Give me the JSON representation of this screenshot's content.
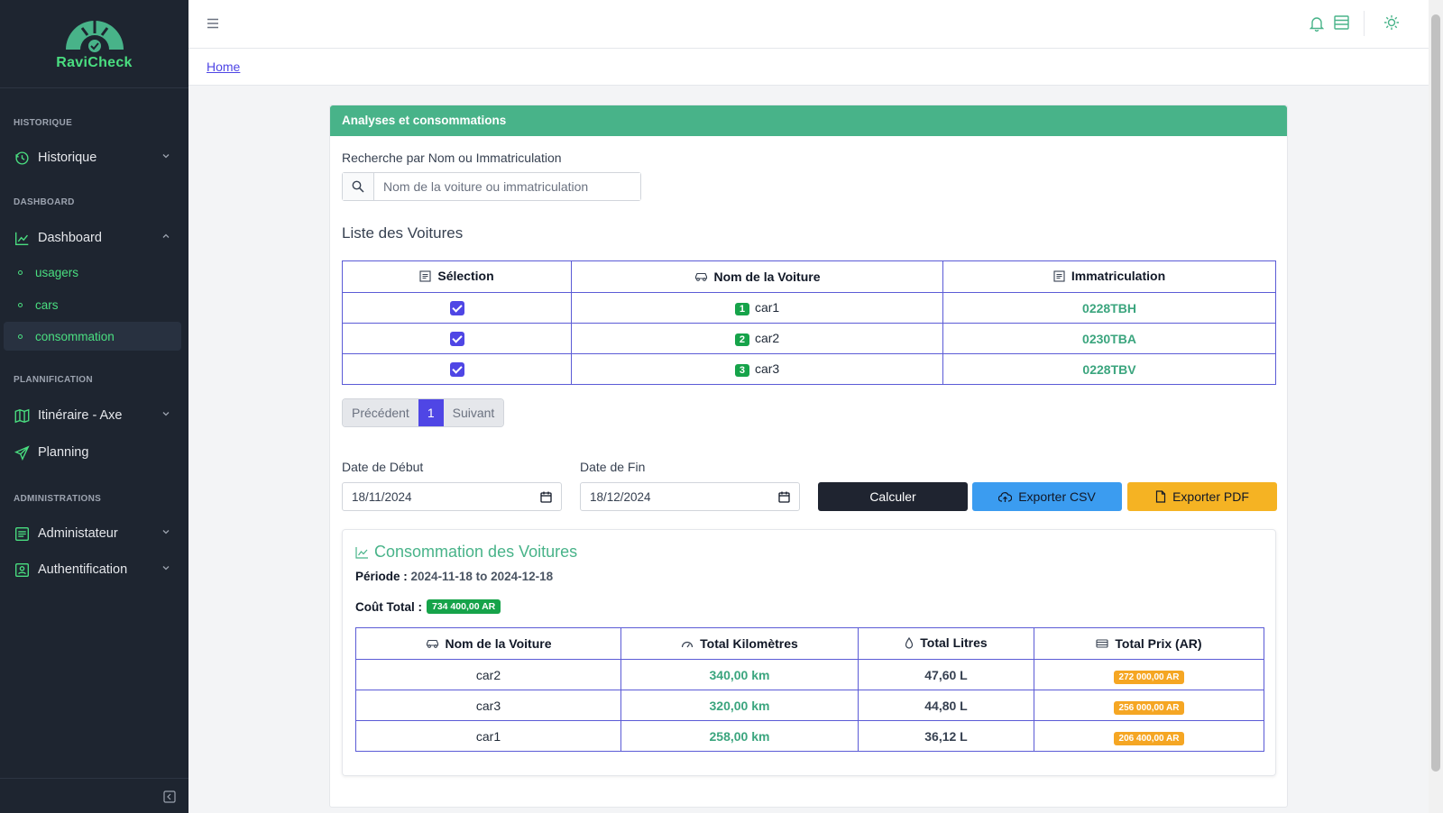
{
  "brand": {
    "name": "RaviCheck"
  },
  "sidebar": {
    "sections": [
      {
        "label": "HISTORIQUE"
      },
      {
        "label": "DASHBOARD"
      },
      {
        "label": "PLANNIFICATION"
      },
      {
        "label": "ADMINISTRATIONS"
      }
    ],
    "items": {
      "historique": "Historique",
      "dashboard": "Dashboard",
      "usagers": "usagers",
      "cars": "cars",
      "consommation": "consommation",
      "itineraire": "Itinéraire - Axe",
      "planning": "Planning",
      "administrateur": "Administateur",
      "authentification": "Authentification"
    }
  },
  "breadcrumb": {
    "home": "Home"
  },
  "card": {
    "title": "Analyses et consommations",
    "search_label": "Recherche par Nom ou Immatriculation",
    "search_placeholder": "Nom de la voiture ou immatriculation",
    "list_title": "Liste des Voitures",
    "cars_table": {
      "headers": [
        "Sélection",
        "Nom de la Voiture",
        "Immatriculation"
      ],
      "rows": [
        {
          "num": "1",
          "name": "car1",
          "immat": "0228TBH"
        },
        {
          "num": "2",
          "name": "car2",
          "immat": "0230TBA"
        },
        {
          "num": "3",
          "name": "car3",
          "immat": "0228TBV"
        }
      ]
    },
    "pager": {
      "prev": "Précédent",
      "page": "1",
      "next": "Suivant"
    },
    "date_debut_label": "Date de Début",
    "date_debut_value": "18/11/2024",
    "date_fin_label": "Date de Fin",
    "date_fin_value": "18/12/2024",
    "btn_calculer": "Calculer",
    "btn_csv": "Exporter CSV",
    "btn_pdf": "Exporter PDF"
  },
  "consommation": {
    "title": "Consommation des Voitures",
    "periode_label": "Période :",
    "periode_value": "2024-11-18 to 2024-12-18",
    "cout_label": "Coût Total :",
    "cout_value": "734 400,00 AR",
    "headers": [
      "Nom de la Voiture",
      "Total Kilomètres",
      "Total Litres",
      "Total Prix (AR)"
    ],
    "rows": [
      {
        "name": "car2",
        "km": "340,00 km",
        "litres": "47,60 L",
        "prix": "272 000,00 AR"
      },
      {
        "name": "car3",
        "km": "320,00 km",
        "litres": "44,80 L",
        "prix": "256 000,00 AR"
      },
      {
        "name": "car1",
        "km": "258,00 km",
        "litres": "36,12 L",
        "prix": "206 400,00 AR"
      }
    ]
  },
  "colors": {
    "accent_green": "#48b389",
    "primary": "#4f46e5",
    "sidebar_bg": "#1e2530"
  }
}
